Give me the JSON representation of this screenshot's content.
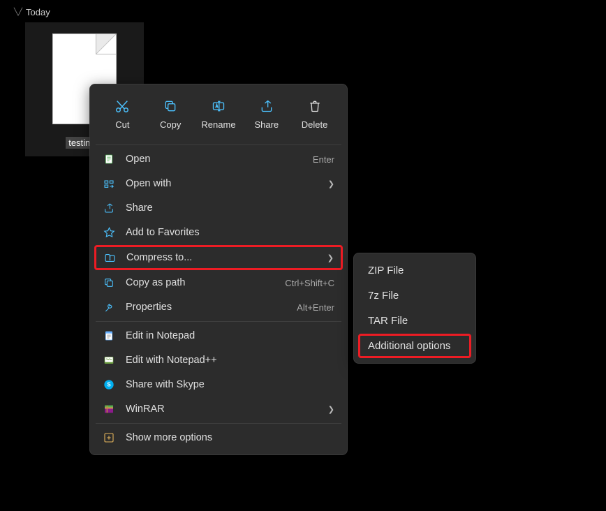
{
  "group_header": "Today",
  "file": {
    "name": "testing_"
  },
  "toolbar": {
    "cut_label": "Cut",
    "copy_label": "Copy",
    "rename_label": "Rename",
    "share_label": "Share",
    "delete_label": "Delete"
  },
  "menu": {
    "open": {
      "label": "Open",
      "hint": "Enter"
    },
    "open_with": {
      "label": "Open with"
    },
    "share": {
      "label": "Share"
    },
    "favorites": {
      "label": "Add to Favorites"
    },
    "compress": {
      "label": "Compress to..."
    },
    "copy_path": {
      "label": "Copy as path",
      "hint": "Ctrl+Shift+C"
    },
    "properties": {
      "label": "Properties",
      "hint": "Alt+Enter"
    },
    "edit_notepad": {
      "label": "Edit in Notepad"
    },
    "edit_notepadpp": {
      "label": "Edit with Notepad++"
    },
    "skype": {
      "label": "Share with Skype"
    },
    "winrar": {
      "label": "WinRAR"
    },
    "more": {
      "label": "Show more options"
    }
  },
  "submenu": {
    "zip": "ZIP File",
    "seven_z": "7z File",
    "tar": "TAR File",
    "additional": "Additional options"
  }
}
